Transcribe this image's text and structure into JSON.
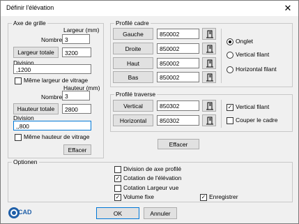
{
  "window": {
    "title": "Définir l'élévation",
    "close_glyph": "✕"
  },
  "axes": {
    "group_title": "Axe de grille",
    "width_header": "Largeur (mm)",
    "nombre_label": "Nombre",
    "nombre_value": "3",
    "largeur_totale_btn": "Largeur totale",
    "largeur_totale_value": "3200",
    "division_label": "Division",
    "division_value": ",1200",
    "meme_largeur_label": "Même largeur de vitrage",
    "height_header": "Hauteur (mm)",
    "nombre2_label": "Nombre",
    "nombre2_value": "3",
    "hauteur_totale_btn": "Hauteur totale",
    "hauteur_totale_value": "2800",
    "division2_label": "Division",
    "division2_value": ",,800",
    "meme_hauteur_label": "Même hauteur de vitrage",
    "effacer_btn": "Effacer"
  },
  "profile_cadre": {
    "group_title": "Profilé cadre",
    "rows": [
      {
        "label": "Gauche",
        "value": "850002"
      },
      {
        "label": "Droite",
        "value": "850002"
      },
      {
        "label": "Haut",
        "value": "850002"
      },
      {
        "label": "Bas",
        "value": "850002"
      }
    ],
    "radios": [
      {
        "label": "Onglet",
        "selected": true
      },
      {
        "label": "Vertical filant",
        "selected": false
      },
      {
        "label": "Horizontal filant",
        "selected": false
      }
    ]
  },
  "profile_traverse": {
    "group_title": "Profilé traverse",
    "rows": [
      {
        "label": "Vertical",
        "value": "850302"
      },
      {
        "label": "Horizontal",
        "value": "850302"
      }
    ],
    "vertical_filant_label": "Vertical filant",
    "couper_cadre_label": "Couper le cadre"
  },
  "effacer_right_btn": "Effacer",
  "options": {
    "group_title": "Optionen",
    "division_axe_label": "Division de axe profilé",
    "cotation_elevation_label": "Cotation de l'élévation",
    "cotation_largeur_label": "Cotation Largeur vue",
    "volume_fixe_label": "Volume fixe",
    "enregistrer_label": "Enregistrer"
  },
  "footer": {
    "ok_btn": "OK",
    "annuler_btn": "Annuler",
    "logo_text": "CAD"
  },
  "icons": {
    "close": "close-icon",
    "profile_pick": "profile-picker-icon",
    "logo": "app-logo"
  }
}
